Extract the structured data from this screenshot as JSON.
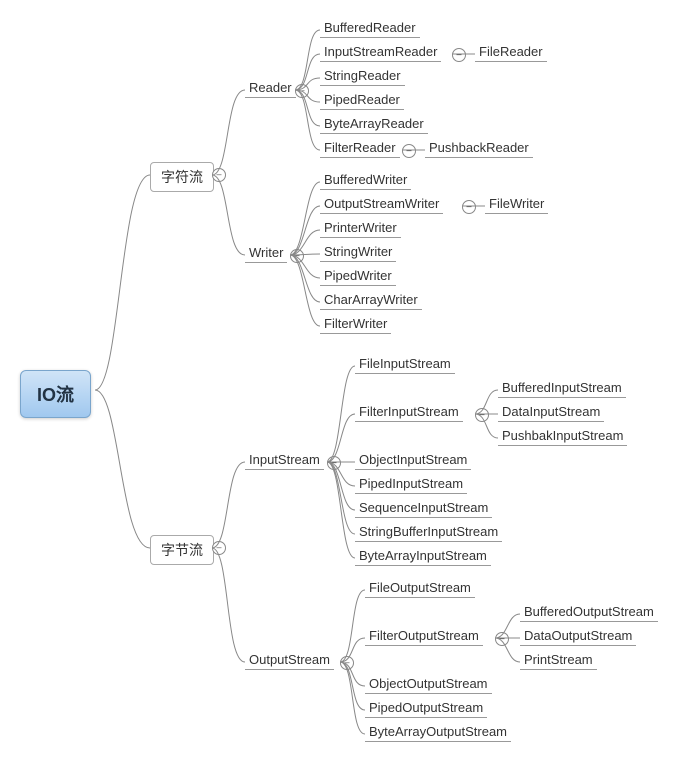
{
  "chart_data": {
    "type": "tree",
    "root": "IO流",
    "children": [
      {
        "label": "字符流",
        "children": [
          {
            "label": "Reader",
            "children": [
              {
                "label": "BufferedReader"
              },
              {
                "label": "InputStreamReader",
                "children": [
                  {
                    "label": "FileReader"
                  }
                ]
              },
              {
                "label": "StringReader"
              },
              {
                "label": "PipedReader"
              },
              {
                "label": "ByteArrayReader"
              },
              {
                "label": "FilterReader",
                "children": [
                  {
                    "label": "PushbackReader"
                  }
                ]
              }
            ]
          },
          {
            "label": "Writer",
            "children": [
              {
                "label": "BufferedWriter"
              },
              {
                "label": "OutputStreamWriter",
                "children": [
                  {
                    "label": "FileWriter"
                  }
                ]
              },
              {
                "label": "PrinterWriter"
              },
              {
                "label": "StringWriter"
              },
              {
                "label": "PipedWriter"
              },
              {
                "label": "CharArrayWriter"
              },
              {
                "label": "FilterWriter"
              }
            ]
          }
        ]
      },
      {
        "label": "字节流",
        "children": [
          {
            "label": "InputStream",
            "children": [
              {
                "label": "FileInputStream"
              },
              {
                "label": "FilterInputStream",
                "children": [
                  {
                    "label": "BufferedInputStream"
                  },
                  {
                    "label": "DataInputStream"
                  },
                  {
                    "label": "PushbakInputStream"
                  }
                ]
              },
              {
                "label": "ObjectInputStream"
              },
              {
                "label": "PipedInputStream"
              },
              {
                "label": "SequenceInputStream"
              },
              {
                "label": "StringBufferInputStream"
              },
              {
                "label": "ByteArrayInputStream"
              }
            ]
          },
          {
            "label": "OutputStream",
            "children": [
              {
                "label": "FileOutputStream"
              },
              {
                "label": "FilterOutputStream",
                "children": [
                  {
                    "label": "BufferedOutputStream"
                  },
                  {
                    "label": "DataOutputStream"
                  },
                  {
                    "label": "PrintStream"
                  }
                ]
              },
              {
                "label": "ObjectOutputStream"
              },
              {
                "label": "PipedOutputStream"
              },
              {
                "label": "ByteArrayOutputStream"
              }
            ]
          }
        ]
      }
    ]
  },
  "toggle_glyph": "–"
}
